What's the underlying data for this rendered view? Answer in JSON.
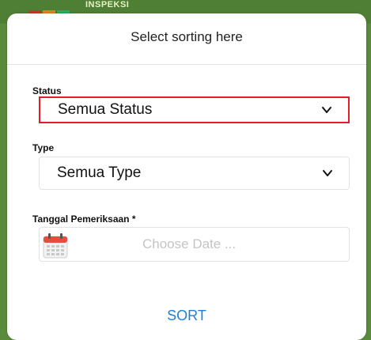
{
  "background": {
    "header_text": "INSPEKSI"
  },
  "modal": {
    "title": "Select sorting here",
    "status": {
      "label": "Status",
      "value": "Semua Status"
    },
    "type": {
      "label": "Type",
      "value": "Semua Type"
    },
    "date": {
      "label": "Tanggal Pemeriksaan *",
      "placeholder": "Choose Date ..."
    },
    "sort_label": "SORT"
  },
  "colors": {
    "accent": "#1e7fd6",
    "highlight": "#e01e2a",
    "background": "#5a8a3c"
  },
  "icons": [
    "chevron-down-icon",
    "calendar-icon"
  ]
}
